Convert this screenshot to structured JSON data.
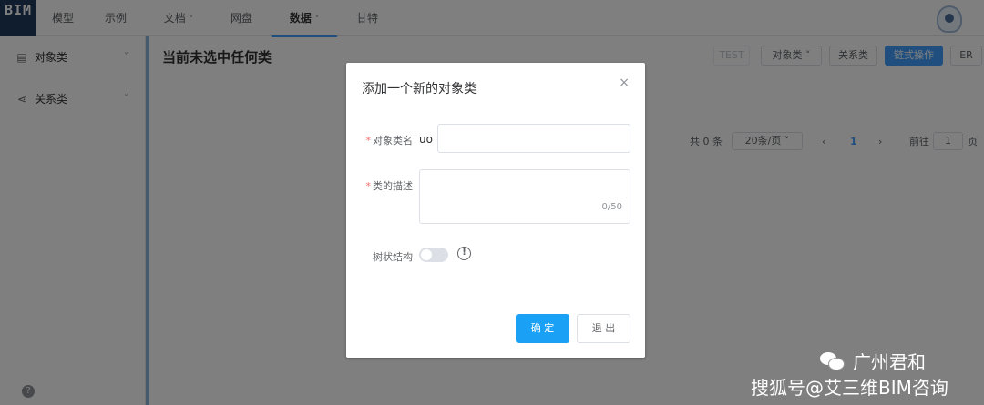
{
  "logo": "BIM",
  "nav": {
    "items": [
      {
        "label": "模型",
        "dropdown": false
      },
      {
        "label": "示例",
        "dropdown": false
      },
      {
        "label": "文档",
        "dropdown": true
      },
      {
        "label": "网盘",
        "dropdown": false
      },
      {
        "label": "数据",
        "dropdown": true,
        "active": true
      },
      {
        "label": "甘特",
        "dropdown": false
      }
    ],
    "chevron": "˅"
  },
  "sidebar": {
    "items": [
      {
        "label": "对象类",
        "icon": "document-icon",
        "glyph": "▤"
      },
      {
        "label": "关系类",
        "icon": "share-icon",
        "glyph": "⋖"
      }
    ],
    "chevron": "˅",
    "help": "?"
  },
  "main": {
    "title": "当前未选中任何类",
    "toolbar": {
      "test": "TEST",
      "object_class": "对象类",
      "relation_class": "关系类",
      "chain_ops": "链式操作",
      "er": "ER"
    },
    "pager": {
      "total": "共 0 条",
      "page_size": "20条/页",
      "prev": "‹",
      "current": "1",
      "next": "›",
      "goto": "前往",
      "goto_value": "1",
      "page_suffix": "页"
    }
  },
  "dialog": {
    "title": "添加一个新的对象类",
    "close": "×",
    "name_label": "对象类名",
    "name_prefix": "uo",
    "desc_label": "类的描述",
    "desc_counter": "0/50",
    "tree_label": "树状结构",
    "info": "!",
    "required_mark": "*",
    "ok": "确 定",
    "cancel": "退 出"
  },
  "watermark": {
    "line1": "广州君和",
    "line2": "搜狐号@艾三维BIM咨询"
  }
}
